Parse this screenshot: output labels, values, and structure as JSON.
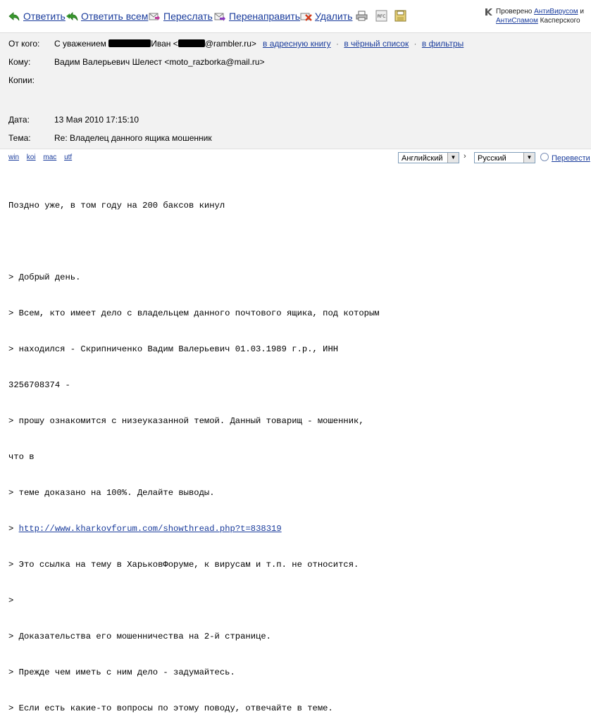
{
  "toolbar": {
    "reply": "Ответить",
    "reply_all": "Ответить всем",
    "forward": "Переслать",
    "redirect": "Перенаправить",
    "delete": "Удалить",
    "print_icon": "printer-icon",
    "rfc_icon": "rfc-icon",
    "rfc_label": "RFC",
    "save_icon": "save-icon"
  },
  "antivirus": {
    "prefix": "Проверено",
    "antivirus_link": "АнтиВирусом",
    "and": "и",
    "antispam_link": "АнтиСпамом",
    "suffix": "Касперского"
  },
  "header": {
    "from_label": "От кого:",
    "from_prefix": "С уважением",
    "from_name": "Иван <",
    "from_domain": "@rambler.ru>",
    "add_to_book": "в адресную книгу",
    "blacklist": "в чёрный список",
    "filters": "в фильтры",
    "to_label": "Кому:",
    "to_value": "Вадим Валерьевич Шелест <moto_razborka@mail.ru>",
    "cc_label": "Копии:",
    "date_label": "Дата:",
    "date_value": "13 Мая 2010 17:15:10",
    "subject_label": "Тема:",
    "subject_value": "Re: Владелец данного ящика мошенник"
  },
  "encodings": [
    "win",
    "koi",
    "mac",
    "utf"
  ],
  "translate": {
    "source_lang": "Английский",
    "target_lang": "Русский",
    "swap": "›",
    "translate_link": "Перевести"
  },
  "body": {
    "lines": [
      "Поздно уже, в том году на 200 баксов кинул",
      "",
      "> Добрый день.",
      "> Всем, кто имеет дело с владельцем данного почтового ящика, под которым",
      "> находился - Скрипниченко Вадим Валерьевич 01.03.1989 г.р., ИНН",
      "3256708374 -",
      "> прошу ознакомится с низеуказанной темой. Данный товарищ - мошенник,",
      "что в",
      "> теме доказано на 100%. Делайте выводы.",
      "> ",
      "> Это ссылка на тему в ХарьковФоруме, к вирусам и т.п. не относится.",
      ">",
      "> Доказательства его мошенничества на 2-й странице.",
      "> Прежде чем иметь с ним дело - задумайтесь.",
      "> Если есть какие-то вопросы по этому поводу, отвечайте в теме."
    ],
    "link": "http://www.kharkovforum.com/showthread.php?t=838319"
  },
  "colors": {
    "link": "#1a3c9c",
    "header_bg": "#f2f2f2"
  }
}
